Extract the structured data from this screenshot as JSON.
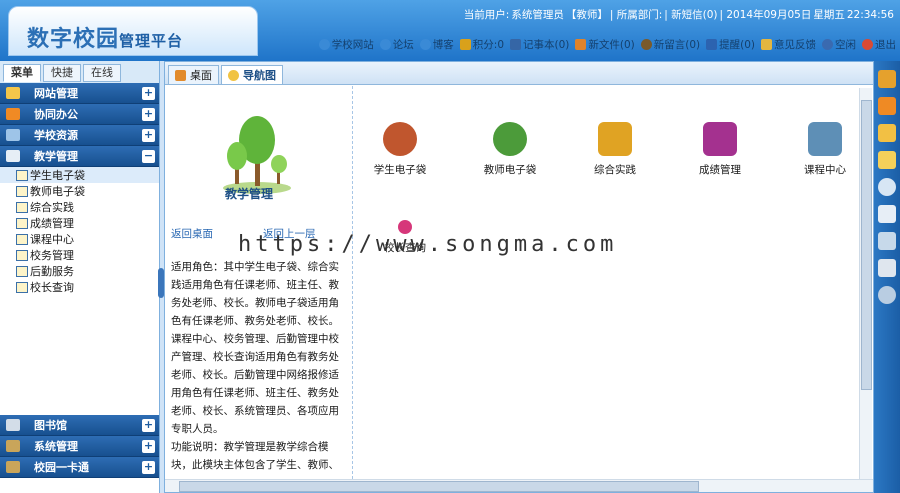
{
  "header": {
    "logo_main": "数字校园",
    "logo_sub": "管理平台",
    "user_label": "当前用户:",
    "user_name": "系统管理员",
    "user_role": "【教师】",
    "dept_label": "| 所属部门:",
    "sms": "| 新短信(0)",
    "date": "| 2014年09月05日",
    "weekday": "星期五",
    "time": "22:34:56",
    "toolbar": [
      {
        "label": "学校网站",
        "icon": "globe-icon",
        "color": "#3a8ad6"
      },
      {
        "label": "论坛",
        "icon": "forum-icon",
        "color": "#3a8ad6"
      },
      {
        "label": "博客",
        "icon": "blog-icon",
        "color": "#3a8ad6"
      },
      {
        "label": "积分:0",
        "icon": "points-icon",
        "color": "#d9a11b"
      },
      {
        "label": "记事本(0)",
        "icon": "notebook-icon",
        "color": "#3566a6"
      },
      {
        "label": "新文件(0)",
        "icon": "file-icon",
        "color": "#e0832a"
      },
      {
        "label": "新留言(0)",
        "icon": "message-icon",
        "color": "#7a5a2a"
      },
      {
        "label": "提醒(0)",
        "icon": "reminder-icon",
        "color": "#2c63b0"
      },
      {
        "label": "意见反馈",
        "icon": "feedback-icon",
        "color": "#e3b640"
      },
      {
        "label": "空闲",
        "icon": "status-icon",
        "color": "#3a6ab0"
      },
      {
        "label": "退出",
        "icon": "exit-icon",
        "color": "#d94a33"
      }
    ]
  },
  "nav": {
    "tabs": [
      "菜单",
      "快捷",
      "在线"
    ],
    "sections_top": [
      {
        "label": "网站管理",
        "toggle": "+"
      },
      {
        "label": "协同办公",
        "toggle": "+"
      },
      {
        "label": "学校资源",
        "toggle": "+"
      },
      {
        "label": "教学管理",
        "toggle": "−"
      }
    ],
    "items": [
      "学生电子袋",
      "教师电子袋",
      "综合实践",
      "成绩管理",
      "课程中心",
      "校务管理",
      "后勤服务",
      "校长查询"
    ],
    "sections_bottom": [
      {
        "label": "图书馆",
        "toggle": "+"
      },
      {
        "label": "系统管理",
        "toggle": "+"
      },
      {
        "label": "校园一卡通",
        "toggle": "+"
      }
    ]
  },
  "tabs": [
    {
      "label": "桌面",
      "icon": "home-icon"
    },
    {
      "label": "导航图",
      "icon": "navigation-icon"
    }
  ],
  "left": {
    "title": "教学管理",
    "back_home": "返回桌面",
    "back_up": "返回上一层",
    "desc": "    适用角色：其中学生电子袋、综合实践适用角色有任课老师、班主任、教务处老师、校长。教师电子袋适用角色有任课老师、教务处老师、校长。课程中心、校务管理、后勤管理中校产管理、校长查询适用角色有教务处老师、校长。后勤管理中网络报修适用角色有任课老师、班主任、教务处老师、校长、系统管理员、各项应用专职人员。\n功能说明：教学管理是教学综合模块，此模块主体包含了学生、教师、"
  },
  "modules": [
    {
      "label": "学生电子袋",
      "color": "#c0562e"
    },
    {
      "label": "教师电子袋",
      "color": "#4c9b3a"
    },
    {
      "label": "综合实践",
      "color": "#e0a323"
    },
    {
      "label": "成绩管理",
      "color": "#a4318f"
    },
    {
      "label": "课程中心",
      "color": "#5e8fb6"
    },
    {
      "label": "校长查询",
      "color": "#d6377a"
    }
  ],
  "watermark": "https://www.songma.com"
}
